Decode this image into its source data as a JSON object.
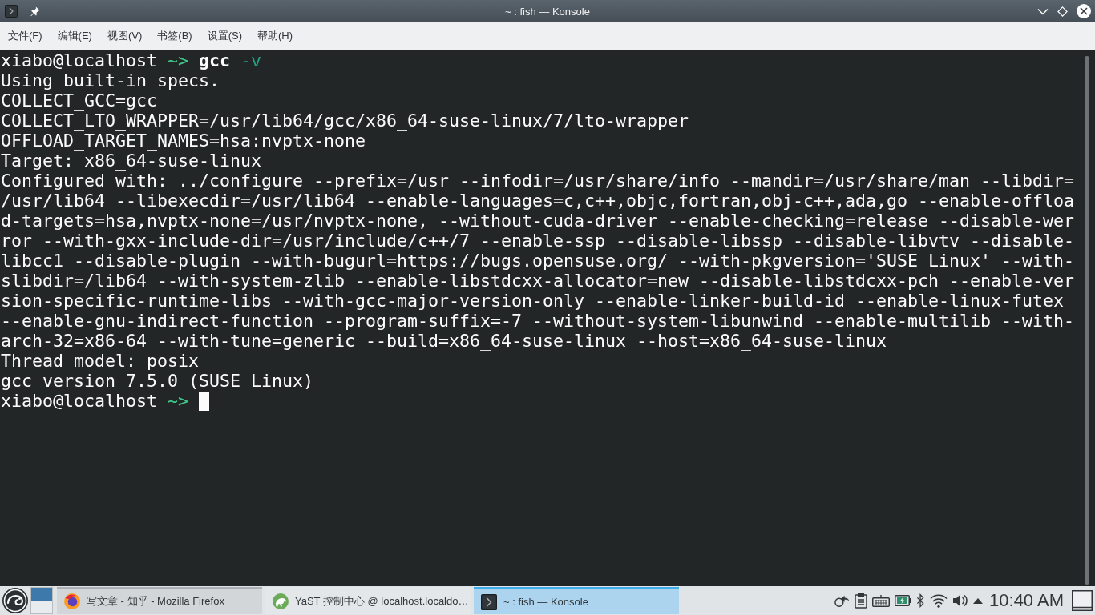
{
  "window": {
    "title": "~ : fish — Konsole"
  },
  "menu_bar": {
    "items": [
      "文件(F)",
      "编辑(E)",
      "视图(V)",
      "书签(B)",
      "设置(S)",
      "帮助(H)"
    ]
  },
  "terminal": {
    "lines": [
      {
        "kind": "prompt",
        "user_host": "xiabo@localhost",
        "path": "~>",
        "command": "gcc",
        "argument": "-v"
      },
      {
        "kind": "output",
        "text": "Using built-in specs."
      },
      {
        "kind": "output",
        "text": "COLLECT_GCC=gcc"
      },
      {
        "kind": "output",
        "text": "COLLECT_LTO_WRAPPER=/usr/lib64/gcc/x86_64-suse-linux/7/lto-wrapper"
      },
      {
        "kind": "output",
        "text": "OFFLOAD_TARGET_NAMES=hsa:nvptx-none"
      },
      {
        "kind": "output",
        "text": "Target: x86_64-suse-linux"
      },
      {
        "kind": "output",
        "text": "Configured with: ../configure --prefix=/usr --infodir=/usr/share/info --mandir=/usr/share/man --libdir="
      },
      {
        "kind": "output",
        "text": "/usr/lib64 --libexecdir=/usr/lib64 --enable-languages=c,c++,objc,fortran,obj-c++,ada,go --enable-offloa"
      },
      {
        "kind": "output",
        "text": "d-targets=hsa,nvptx-none=/usr/nvptx-none, --without-cuda-driver --enable-checking=release --disable-wer"
      },
      {
        "kind": "output",
        "text": "ror --with-gxx-include-dir=/usr/include/c++/7 --enable-ssp --disable-libssp --disable-libvtv --disable-"
      },
      {
        "kind": "output",
        "text": "libcc1 --disable-plugin --with-bugurl=https://bugs.opensuse.org/ --with-pkgversion='SUSE Linux' --with-"
      },
      {
        "kind": "output",
        "text": "slibdir=/lib64 --with-system-zlib --enable-libstdcxx-allocator=new --disable-libstdcxx-pch --enable-ver"
      },
      {
        "kind": "output",
        "text": "sion-specific-runtime-libs --with-gcc-major-version-only --enable-linker-build-id --enable-linux-futex"
      },
      {
        "kind": "output",
        "text": "--enable-gnu-indirect-function --program-suffix=-7 --without-system-libunwind --enable-multilib --with-"
      },
      {
        "kind": "output",
        "text": "arch-32=x86-64 --with-tune=generic --build=x86_64-suse-linux --host=x86_64-suse-linux"
      },
      {
        "kind": "output",
        "text": "Thread model: posix"
      },
      {
        "kind": "output",
        "text": "gcc version 7.5.0 (SUSE Linux)"
      },
      {
        "kind": "prompt",
        "user_host": "xiabo@localhost",
        "path": "~>",
        "cursor": true
      }
    ]
  },
  "taskbar": {
    "tasks": [
      {
        "kind": "browser",
        "label": "写文章 - 知乎 - Mozilla Firefox",
        "selected": false,
        "minimized": false
      },
      {
        "kind": "control-center",
        "label": "YaST 控制中心 @ localhost.localdo…",
        "selected": false,
        "minimized": true
      },
      {
        "kind": "terminal",
        "label": "~ : fish — Konsole",
        "selected": true,
        "minimized": false
      }
    ],
    "clock": "10:40 AM"
  }
}
